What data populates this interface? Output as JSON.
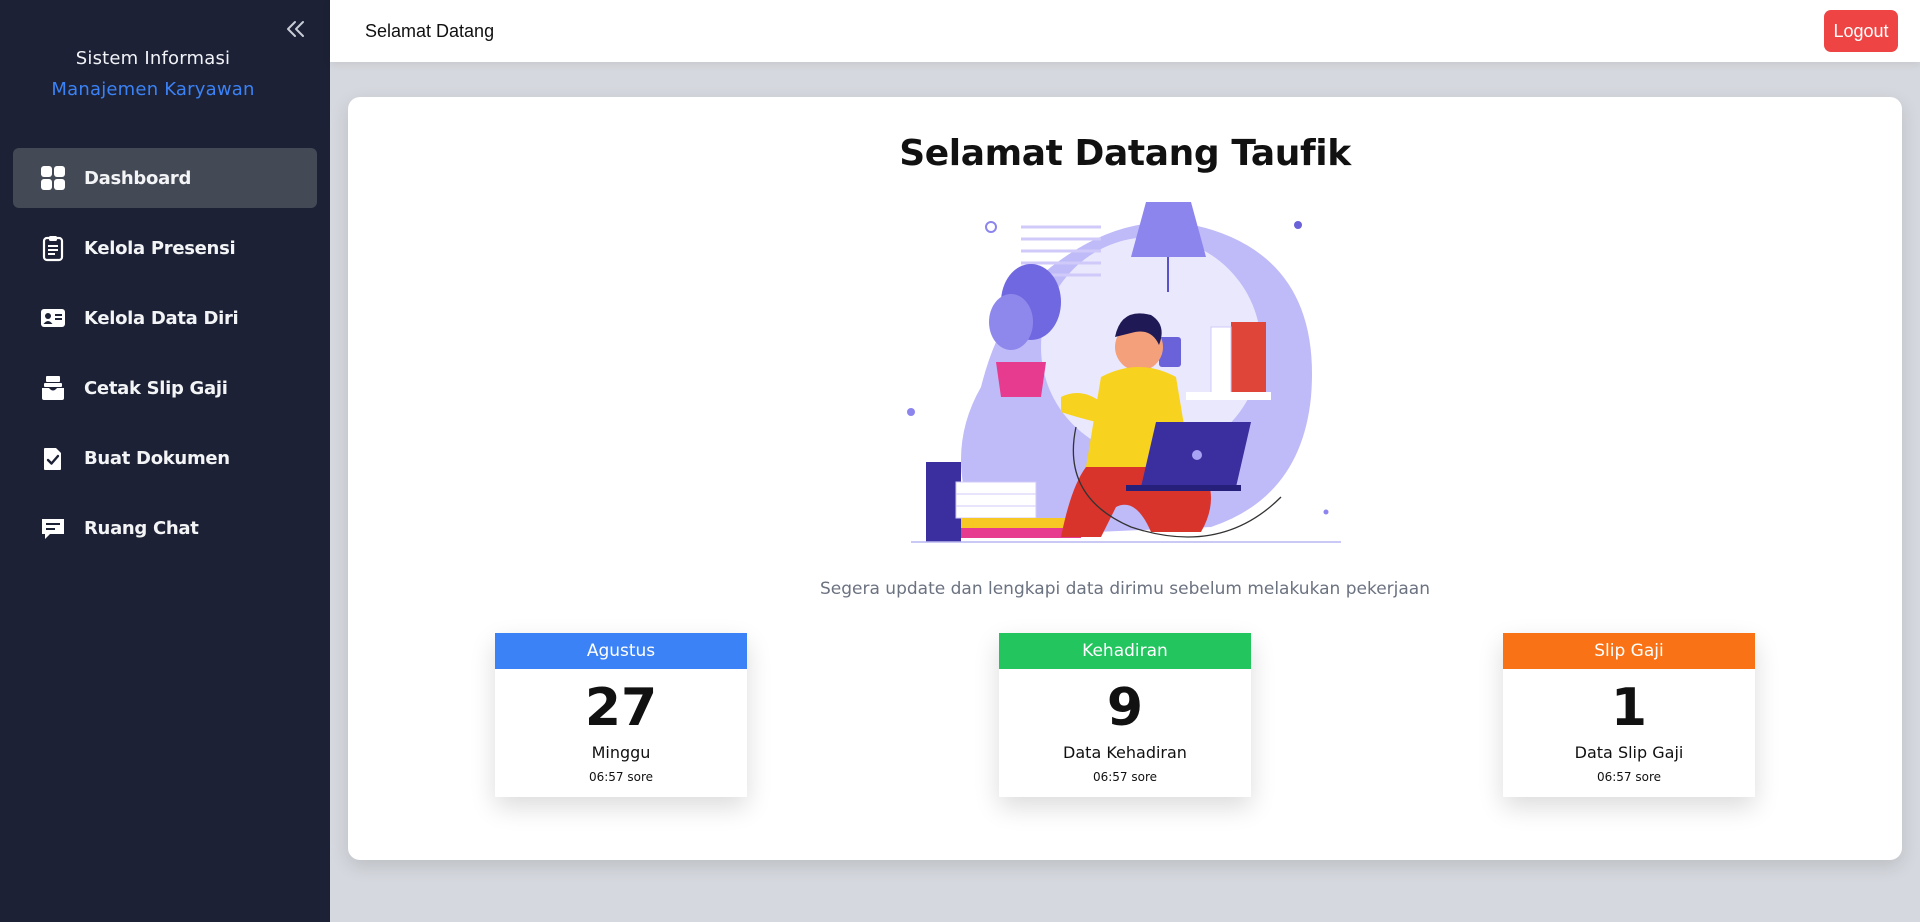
{
  "sidebar": {
    "brand_line1": "Sistem Informasi",
    "brand_line2": "Manajemen Karyawan",
    "items": [
      {
        "label": "Dashboard",
        "icon": "grid-icon",
        "active": true
      },
      {
        "label": "Kelola Presensi",
        "icon": "clipboard-icon"
      },
      {
        "label": "Kelola Data Diri",
        "icon": "id-card-icon"
      },
      {
        "label": "Cetak Slip Gaji",
        "icon": "inbox-icon"
      },
      {
        "label": "Buat Dokumen",
        "icon": "document-check-icon"
      },
      {
        "label": "Ruang Chat",
        "icon": "chat-icon"
      }
    ]
  },
  "topbar": {
    "title": "Selamat Datang",
    "logout_label": "Logout"
  },
  "main": {
    "welcome": "Selamat Datang Taufik",
    "subtitle": "Segera update dan lengkapi data dirimu sebelum melakukan pekerjaan",
    "stats": [
      {
        "header": "Agustus",
        "value": "27",
        "label": "Minggu",
        "time": "06:57 sore",
        "color": "#3b82f6"
      },
      {
        "header": "Kehadiran",
        "value": "9",
        "label": "Data Kehadiran",
        "time": "06:57 sore",
        "color": "#22c55e"
      },
      {
        "header": "Slip Gaji",
        "value": "1",
        "label": "Data Slip Gaji",
        "time": "06:57 sore",
        "color": "#f97316"
      }
    ]
  },
  "colors": {
    "sidebar_bg": "#1c2136",
    "accent_blue": "#3b82f6",
    "logout_red": "#ef4444"
  }
}
